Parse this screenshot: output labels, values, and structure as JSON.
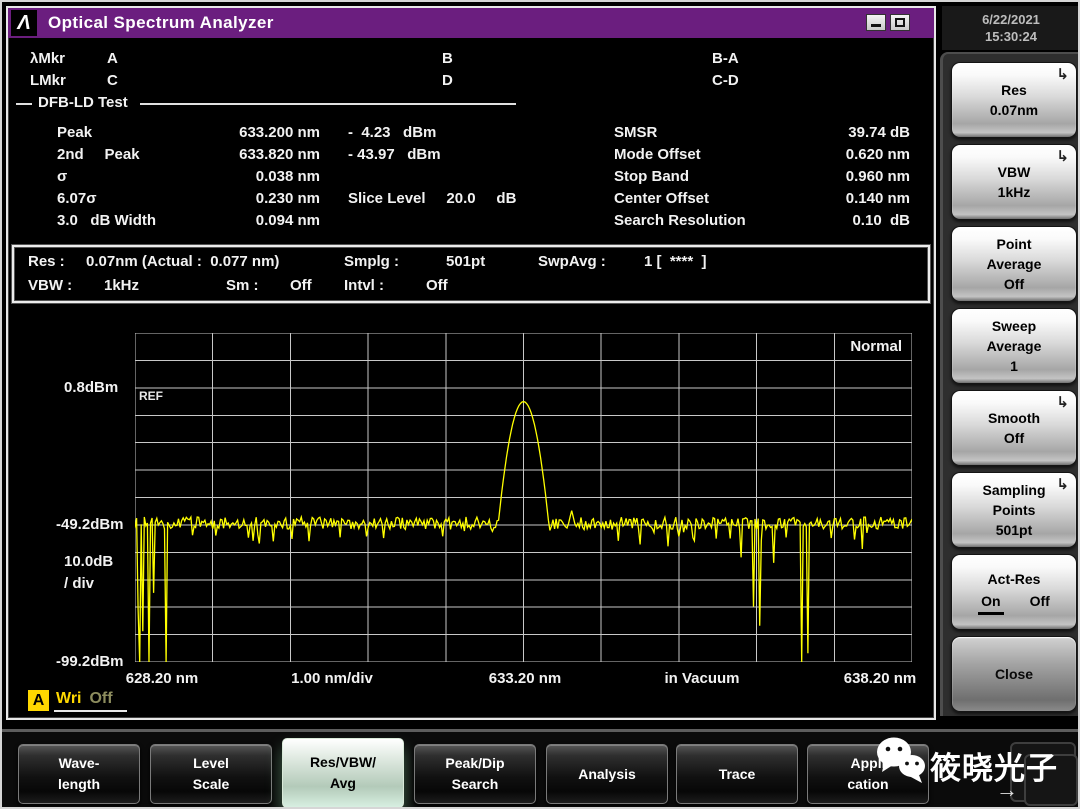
{
  "window": {
    "logo": "Λ",
    "title": "Optical Spectrum Analyzer",
    "datetime_date": "6/22/2021",
    "datetime_time": "15:30:24"
  },
  "markers": {
    "rows": [
      {
        "label": "λMkr",
        "a": "A",
        "b": "B",
        "diff": "B-A"
      },
      {
        "label": "LMkr",
        "a": "C",
        "b": "D",
        "diff": "C-D"
      }
    ]
  },
  "analysis": {
    "section_title": "DFB-LD Test",
    "left_rows": [
      {
        "label": "Peak",
        "wavelength": "633.200 nm",
        "level": "-  4.23   dBm"
      },
      {
        "label": "2nd     Peak",
        "wavelength": "633.820 nm",
        "level": "- 43.97   dBm"
      },
      {
        "label": "σ",
        "wavelength": "0.038 nm",
        "level": ""
      },
      {
        "label": "6.07σ",
        "wavelength": "0.230 nm",
        "level": "Slice Level     20.0     dB"
      },
      {
        "label": "3.0   dB Width",
        "wavelength": "0.094 nm",
        "level": ""
      }
    ],
    "right_rows": [
      {
        "label": "SMSR",
        "value": "39.74 dB"
      },
      {
        "label": "Mode Offset",
        "value": "0.620 nm"
      },
      {
        "label": "Stop Band",
        "value": "0.960 nm"
      },
      {
        "label": "Center Offset",
        "value": "0.140 nm"
      },
      {
        "label": "Search Resolution",
        "value": "0.10  dB"
      }
    ]
  },
  "status_bar": {
    "row1": [
      {
        "label": "Res :",
        "value": "0.07nm (Actual :  0.077 nm)"
      },
      {
        "label": "Smplg :",
        "value": "501pt"
      },
      {
        "label": "SwpAvg :",
        "value": "1 [  ****  ]"
      }
    ],
    "row2": [
      {
        "label": "VBW :",
        "value": "1kHz"
      },
      {
        "label": "Sm :",
        "value": "Off"
      },
      {
        "label": "Intvl :",
        "value": "Off"
      }
    ]
  },
  "chart": {
    "trace_mode_label": "Normal",
    "ref_label": "REF",
    "y_axis": {
      "ref": "0.8dBm",
      "mid": "-49.2dBm",
      "per_div_1": "10.0dB",
      "per_div_2": "/ div",
      "bottom": "-99.2dBm"
    },
    "x_axis": {
      "start": "628.20 nm",
      "per_div": "1.00 nm/div",
      "center": "633.20 nm",
      "medium": "in Vacuum",
      "stop": "638.20 nm"
    },
    "trace_status": {
      "trace": "A",
      "mode": "Wri",
      "state": "Off"
    }
  },
  "chart_data": {
    "type": "line",
    "title": "Optical spectrum, trace A (Normal)",
    "x_unit": "nm",
    "y_unit": "dBm",
    "x_range": [
      628.2,
      638.2
    ],
    "x_per_div_nm": 1.0,
    "y_ref_dbm": 0.8,
    "y_per_div_db": 10.0,
    "y_bottom_dbm": -99.2,
    "grid_cols": 10,
    "grid_rows": 12,
    "ref_line_row": 2,
    "sampling_points": 501,
    "peak": {
      "wavelength_nm": 633.2,
      "level_dbm": -4.23
    },
    "second_peak": {
      "wavelength_nm": 633.82,
      "level_dbm": -43.97,
      "width_nm": 0.09
    },
    "noise_floor_dbm": -48.5,
    "noise_amplitude_db": 2.2,
    "peak_shape": {
      "width_nm": 0.33,
      "depth_db": 46
    },
    "dips": [
      {
        "x": 628.24,
        "level": -80
      },
      {
        "x": 628.27,
        "level": -101
      },
      {
        "x": 628.31,
        "level": -88
      },
      {
        "x": 628.38,
        "level": -101
      },
      {
        "x": 628.44,
        "level": -74
      },
      {
        "x": 628.6,
        "level": -102
      },
      {
        "x": 629.72,
        "level": -55
      },
      {
        "x": 631.4,
        "level": -54
      },
      {
        "x": 634.42,
        "level": -55
      },
      {
        "x": 635.06,
        "level": -57
      },
      {
        "x": 635.4,
        "level": -55
      },
      {
        "x": 636.0,
        "level": -61
      },
      {
        "x": 636.17,
        "level": -79
      },
      {
        "x": 636.24,
        "level": -86
      },
      {
        "x": 636.42,
        "level": -63
      },
      {
        "x": 636.79,
        "level": -102
      },
      {
        "x": 636.86,
        "level": -96
      },
      {
        "x": 637.16,
        "level": -54
      },
      {
        "x": 637.56,
        "level": -58
      }
    ]
  },
  "sidebar": {
    "submenu_arrow": "↳",
    "buttons": [
      {
        "line1": "Res",
        "line2": "0.07nm",
        "line3": ""
      },
      {
        "line1": "VBW",
        "line2": "1kHz",
        "line3": ""
      },
      {
        "line1": "Point",
        "line2": "Average",
        "line3": "Off"
      },
      {
        "line1": "Sweep",
        "line2": "Average",
        "line3": "1"
      },
      {
        "line1": "Smooth",
        "line2": "Off",
        "line3": ""
      },
      {
        "line1": "Sampling",
        "line2": "Points",
        "line3": "501pt"
      },
      {
        "title": "Act-Res",
        "on": "On",
        "off": "Off"
      },
      {
        "line1": "Close"
      }
    ]
  },
  "menu": {
    "items": [
      {
        "line1": "Wave-",
        "line2": "length"
      },
      {
        "line1": "Level",
        "line2": "Scale"
      },
      {
        "line1": "Res/VBW/",
        "line2": "Avg"
      },
      {
        "line1": "Peak/Dip",
        "line2": "Search"
      },
      {
        "line1": "Analysis",
        "line2": ""
      },
      {
        "line1": "Trace",
        "line2": ""
      },
      {
        "line1": "Appli",
        "line2": "cation"
      }
    ]
  },
  "watermark": {
    "text": "筱晓光子",
    "arrow": "→"
  },
  "colors": {
    "titlebar_purple": "#6b1e7f",
    "trace_yellow": "#ffff00",
    "grid_gray": "#c8c8c8",
    "indicator_yellow": "#ffd800"
  }
}
